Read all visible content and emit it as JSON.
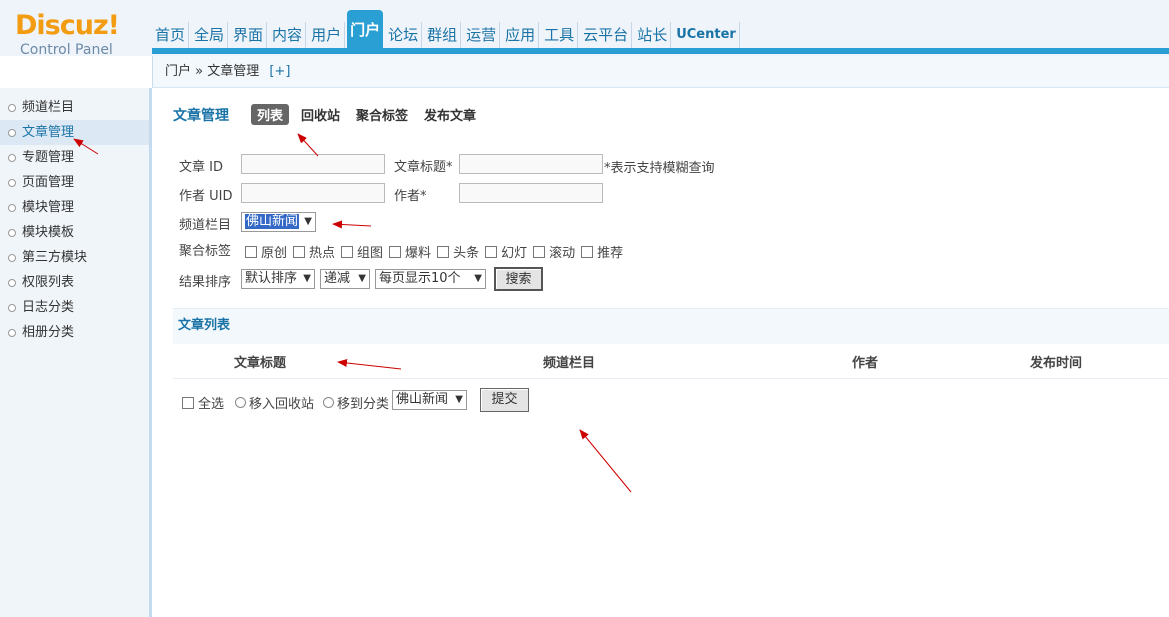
{
  "logo": {
    "main": "Discuz!",
    "sub": "Control Panel"
  },
  "nav": [
    "首页",
    "全局",
    "界面",
    "内容",
    "用户",
    "门户",
    "论坛",
    "群组",
    "运营",
    "应用",
    "工具",
    "云平台",
    "站长",
    "UCenter"
  ],
  "nav_active": "门户",
  "breadcrumb": {
    "text": "门户 » 文章管理",
    "plus": "[+]"
  },
  "sidebar": [
    "频道栏目",
    "文章管理",
    "专题管理",
    "页面管理",
    "模块管理",
    "模块模板",
    "第三方模块",
    "权限列表",
    "日志分类",
    "相册分类"
  ],
  "sidebar_active": "文章管理",
  "page": {
    "title": "文章管理",
    "tabs": [
      "列表",
      "回收站",
      "聚合标签",
      "发布文章"
    ]
  },
  "filter": {
    "article_id_label": "文章 ID",
    "article_title_label": "文章标题*",
    "fuzzy_note": "*表示支持模糊查询",
    "author_uid_label": "作者 UID",
    "author_label": "作者*",
    "channel_label": "频道栏目",
    "channel_value": "佛山新闻",
    "tags_label": "聚合标签",
    "tags": [
      "原创",
      "热点",
      "组图",
      "爆料",
      "头条",
      "幻灯",
      "滚动",
      "推荐"
    ],
    "sort_label": "结果排序",
    "sort_value": "默认排序",
    "order_value": "递减",
    "perpage_value": "每页显示10个",
    "search_button": "搜索"
  },
  "list": {
    "heading": "文章列表",
    "columns": [
      "文章标题",
      "频道栏目",
      "作者",
      "发布时间"
    ],
    "select_all": "全选",
    "move_recycle": "移入回收站",
    "move_category": "移到分类",
    "category_value": "佛山新闻",
    "submit_button": "提交"
  },
  "colors": {
    "accent": "#2a9fd3",
    "link": "#1a73a6",
    "logo": "#f39c12",
    "arrow": "#cc0000"
  }
}
